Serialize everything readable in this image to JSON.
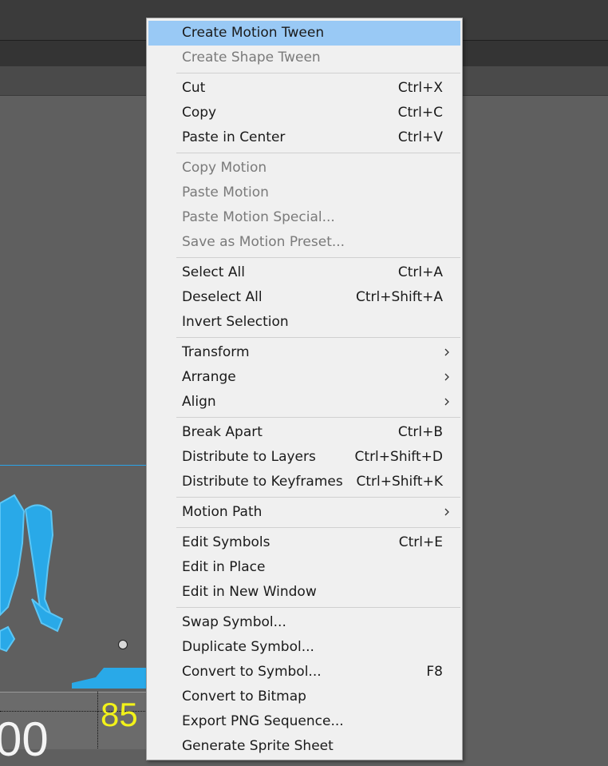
{
  "stage": {
    "number_yellow": "85",
    "number_white": "00"
  },
  "menu": {
    "groups": [
      [
        {
          "label": "Create Motion Tween",
          "shortcut": "",
          "submenu": false,
          "disabled": false,
          "highlighted": true
        },
        {
          "label": "Create Shape Tween",
          "shortcut": "",
          "submenu": false,
          "disabled": true
        }
      ],
      [
        {
          "label": "Cut",
          "shortcut": "Ctrl+X",
          "submenu": false,
          "disabled": false
        },
        {
          "label": "Copy",
          "shortcut": "Ctrl+C",
          "submenu": false,
          "disabled": false
        },
        {
          "label": "Paste in Center",
          "shortcut": "Ctrl+V",
          "submenu": false,
          "disabled": false
        }
      ],
      [
        {
          "label": "Copy Motion",
          "shortcut": "",
          "submenu": false,
          "disabled": true
        },
        {
          "label": "Paste Motion",
          "shortcut": "",
          "submenu": false,
          "disabled": true
        },
        {
          "label": "Paste Motion Special...",
          "shortcut": "",
          "submenu": false,
          "disabled": true
        },
        {
          "label": "Save as Motion Preset...",
          "shortcut": "",
          "submenu": false,
          "disabled": true
        }
      ],
      [
        {
          "label": "Select All",
          "shortcut": "Ctrl+A",
          "submenu": false,
          "disabled": false
        },
        {
          "label": "Deselect All",
          "shortcut": "Ctrl+Shift+A",
          "submenu": false,
          "disabled": false
        },
        {
          "label": "Invert Selection",
          "shortcut": "",
          "submenu": false,
          "disabled": false
        }
      ],
      [
        {
          "label": "Transform",
          "shortcut": "",
          "submenu": true,
          "disabled": false
        },
        {
          "label": "Arrange",
          "shortcut": "",
          "submenu": true,
          "disabled": false
        },
        {
          "label": "Align",
          "shortcut": "",
          "submenu": true,
          "disabled": false
        }
      ],
      [
        {
          "label": "Break Apart",
          "shortcut": "Ctrl+B",
          "submenu": false,
          "disabled": false
        },
        {
          "label": "Distribute to Layers",
          "shortcut": "Ctrl+Shift+D",
          "submenu": false,
          "disabled": false
        },
        {
          "label": "Distribute to Keyframes",
          "shortcut": "Ctrl+Shift+K",
          "submenu": false,
          "disabled": false
        }
      ],
      [
        {
          "label": "Motion Path",
          "shortcut": "",
          "submenu": true,
          "disabled": false
        }
      ],
      [
        {
          "label": "Edit Symbols",
          "shortcut": "Ctrl+E",
          "submenu": false,
          "disabled": false
        },
        {
          "label": "Edit in Place",
          "shortcut": "",
          "submenu": false,
          "disabled": false
        },
        {
          "label": "Edit in New Window",
          "shortcut": "",
          "submenu": false,
          "disabled": false
        }
      ],
      [
        {
          "label": "Swap Symbol...",
          "shortcut": "",
          "submenu": false,
          "disabled": false
        },
        {
          "label": "Duplicate Symbol...",
          "shortcut": "",
          "submenu": false,
          "disabled": false
        },
        {
          "label": "Convert to Symbol...",
          "shortcut": "F8",
          "submenu": false,
          "disabled": false
        },
        {
          "label": "Convert to Bitmap",
          "shortcut": "",
          "submenu": false,
          "disabled": false
        },
        {
          "label": "Export PNG Sequence...",
          "shortcut": "",
          "submenu": false,
          "disabled": false
        },
        {
          "label": "Generate Sprite Sheet",
          "shortcut": "",
          "submenu": false,
          "disabled": false
        }
      ]
    ]
  }
}
